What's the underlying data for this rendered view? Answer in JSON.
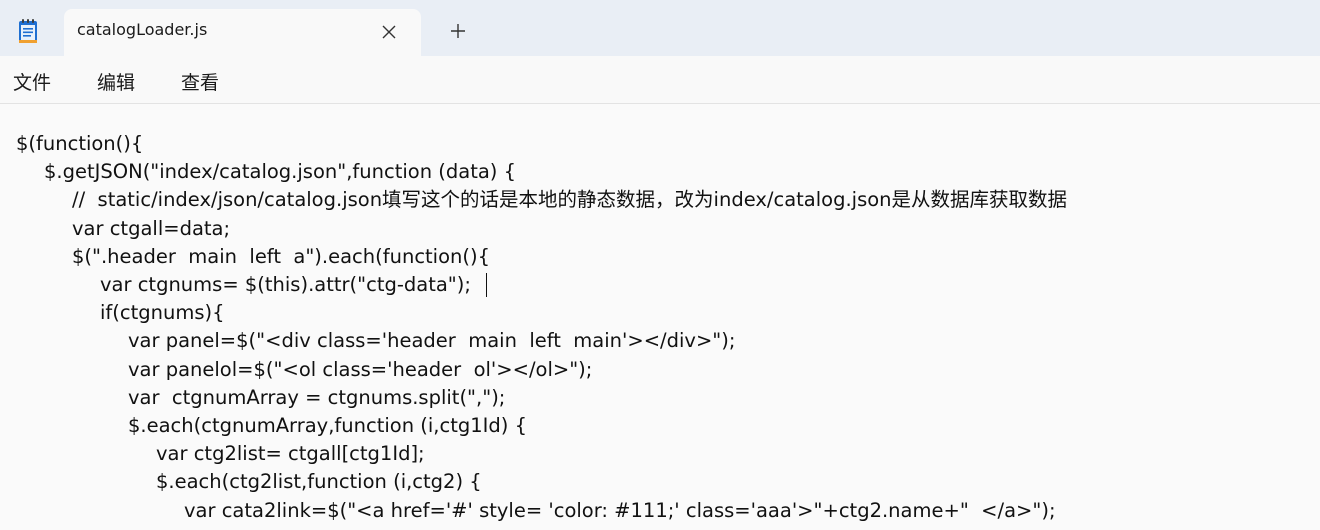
{
  "tab": {
    "title": "catalogLoader.js",
    "close_glyph": "✕",
    "new_tab_glyph": "+"
  },
  "menu": {
    "file": "文件",
    "edit": "编辑",
    "view": "查看"
  },
  "editor": {
    "lines": [
      {
        "indent": 0,
        "text": "$(function(){"
      },
      {
        "indent": 1,
        "text": "$.getJSON(\"index/catalog.json\",function (data) {"
      },
      {
        "indent": 2,
        "text": "//  static/index/json/catalog.json填写这个的话是本地的静态数据，改为index/catalog.json是从数据库获取数据"
      },
      {
        "indent": 2,
        "text": "var ctgall=data;"
      },
      {
        "indent": 2,
        "text": "$(\".header  main  left  a\").each(function(){"
      },
      {
        "indent": 3,
        "text": "var ctgnums= $(this).attr(\"ctg-data\");"
      },
      {
        "indent": 3,
        "text": "if(ctgnums){"
      },
      {
        "indent": 4,
        "text": "var panel=$(\"<div class='header  main  left  main'></div>\");"
      },
      {
        "indent": 4,
        "text": "var panelol=$(\"<ol class='header  ol'></ol>\");"
      },
      {
        "indent": 4,
        "text": "var  ctgnumArray = ctgnums.split(\",\");"
      },
      {
        "indent": 4,
        "text": "$.each(ctgnumArray,function (i,ctg1Id) {"
      },
      {
        "indent": 5,
        "text": "var ctg2list= ctgall[ctg1Id];"
      },
      {
        "indent": 5,
        "text": "$.each(ctg2list,function (i,ctg2) {"
      },
      {
        "indent": 6,
        "text": "var cata2link=$(\"<a href='#' style= 'color: #111;' class='aaa'>\"+ctg2.name+\"  </a>\");"
      }
    ]
  }
}
